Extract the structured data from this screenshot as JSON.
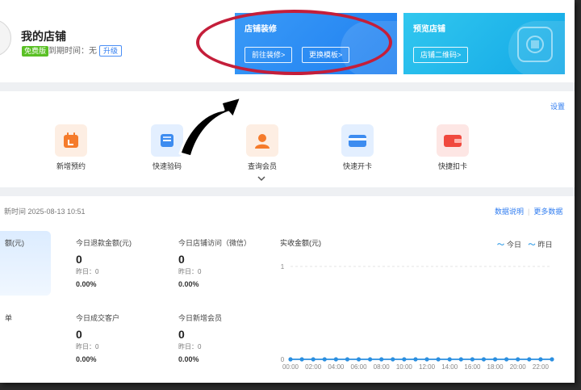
{
  "header": {
    "store_title": "我的店铺",
    "free_badge": "免费版",
    "expire_text": "到期时间：无",
    "upgrade_label": "升级"
  },
  "cards": {
    "decoration": {
      "title": "店铺装修",
      "go_button": "前往装修>",
      "template_button": "更换模板>"
    },
    "preview": {
      "title": "预览店铺",
      "qr_button": "店铺二维码>"
    }
  },
  "quick_actions": {
    "settings_label": "设置",
    "items": [
      {
        "label": "新增预约",
        "icon": "calendar-icon",
        "color": "#f57b2b"
      },
      {
        "label": "快速验码",
        "icon": "scan-icon",
        "color": "#3d8cf0"
      },
      {
        "label": "查询会员",
        "icon": "member-icon",
        "color": "#f57b2b"
      },
      {
        "label": "快速开卡",
        "icon": "card-icon",
        "color": "#3d8cf0"
      },
      {
        "label": "快捷扣卡",
        "icon": "wallet-icon",
        "color": "#f0493e"
      }
    ]
  },
  "stats": {
    "update_time": "新时间 2025-08-13 10:51",
    "explain_link": "数据说明",
    "more_link": "更多数据",
    "highlight_label": "额(元)",
    "left_cut_label": "单",
    "items": [
      {
        "label": "今日退款金额(元)",
        "value": "0",
        "prev": "昨日：0",
        "pct": "0.00%"
      },
      {
        "label": "今日店铺访问（微信）",
        "value": "0",
        "prev": "昨日：0",
        "pct": "0.00%"
      },
      {
        "label": "今日成交客户",
        "value": "0",
        "prev": "昨日：0",
        "pct": "0.00%"
      },
      {
        "label": "今日新增会员",
        "value": "0",
        "prev": "昨日：0",
        "pct": "0.00%"
      }
    ]
  },
  "chart_data": {
    "type": "line",
    "title": "实收金额(元)",
    "x": [
      "00:00",
      "01:00",
      "02:00",
      "03:00",
      "04:00",
      "05:00",
      "06:00",
      "07:00",
      "08:00",
      "09:00",
      "10:00",
      "11:00",
      "12:00",
      "13:00",
      "14:00",
      "15:00",
      "16:00",
      "17:00",
      "18:00",
      "19:00",
      "20:00",
      "21:00",
      "22:00",
      "23:00"
    ],
    "x_tick_labels": [
      "00:00",
      "02:00",
      "04:00",
      "06:00",
      "08:00",
      "10:00",
      "12:00",
      "14:00",
      "16:00",
      "18:00",
      "20:00",
      "22:00"
    ],
    "ylim": [
      0,
      1
    ],
    "y_ticks": [
      "0",
      "1"
    ],
    "series": [
      {
        "name": "今日",
        "values": [
          0,
          0,
          0,
          0,
          0,
          0,
          0,
          0,
          0,
          0,
          0,
          0,
          0,
          0,
          0,
          0,
          0,
          0,
          0,
          0,
          0,
          0,
          0,
          0
        ]
      },
      {
        "name": "昨日",
        "values": [
          0,
          0,
          0,
          0,
          0,
          0,
          0,
          0,
          0,
          0,
          0,
          0,
          0,
          0,
          0,
          0,
          0,
          0,
          0,
          0,
          0,
          0,
          0,
          0
        ]
      }
    ],
    "legend_position": "top-right",
    "grid": true,
    "line_color": "#2b8fe0"
  }
}
